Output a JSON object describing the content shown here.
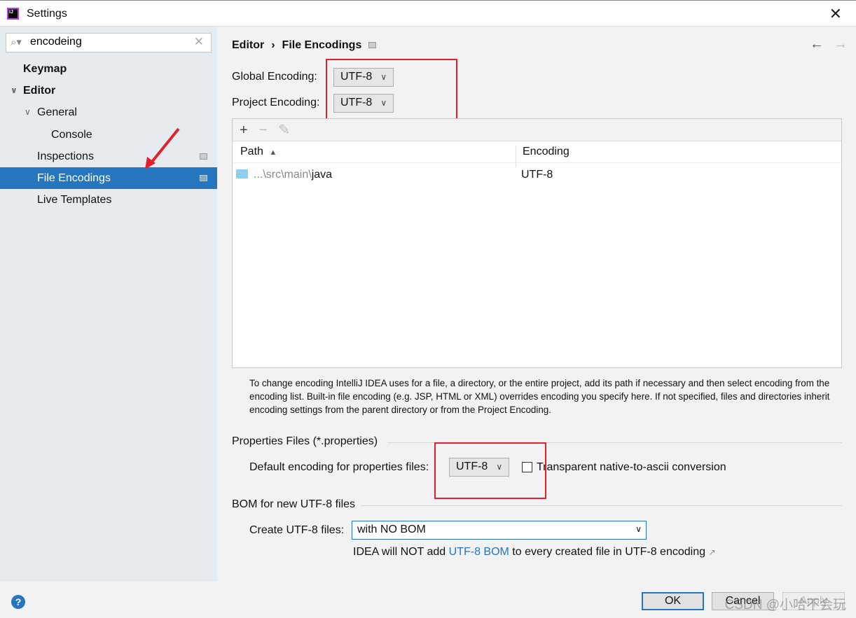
{
  "window": {
    "title": "Settings",
    "logo_text": "IJ",
    "close": "✕"
  },
  "sidebar": {
    "search_value": "encodeing",
    "items": [
      {
        "label": "Keymap"
      },
      {
        "label": "Editor"
      },
      {
        "label": "General"
      },
      {
        "label": "Console"
      },
      {
        "label": "Inspections"
      },
      {
        "label": "File Encodings"
      },
      {
        "label": "Live Templates"
      }
    ]
  },
  "main": {
    "breadcrumb": [
      "Editor",
      "›",
      "File Encodings"
    ],
    "nav_back": "←",
    "nav_forward": "→",
    "global_encoding": {
      "label": "Global Encoding:",
      "value": "UTF-8"
    },
    "project_encoding": {
      "label": "Project Encoding:",
      "value": "UTF-8"
    },
    "toolbar": {
      "add": "+",
      "remove": "−",
      "edit": "✎"
    },
    "table": {
      "columns": [
        "Path",
        "Encoding"
      ],
      "sort_indicator": "▲",
      "rows": [
        {
          "path_prefix": "...\\src\\main\\",
          "path_name": "java",
          "encoding": "UTF-8"
        }
      ]
    },
    "description": "To change encoding IntelliJ IDEA uses for a file, a directory, or the entire project, add its path if necessary and then select encoding from the encoding list. Built-in file encoding (e.g. JSP, HTML or XML) overrides encoding you specify here. If not specified, files and directories inherit encoding settings from the parent directory or from the Project Encoding.",
    "properties": {
      "section": "Properties Files (*.properties)",
      "label": "Default encoding for properties files:",
      "value": "UTF-8",
      "checkbox_label": "Transparent native-to-ascii conversion",
      "checked": false
    },
    "bom": {
      "section": "BOM for new UTF-8 files",
      "label": "Create UTF-8 files:",
      "value": "with NO BOM",
      "note_before": "IDEA will NOT add ",
      "note_link": "UTF-8 BOM",
      "note_after": " to every created file in UTF-8 encoding",
      "note_icon": "↗"
    }
  },
  "footer": {
    "help": "?",
    "ok": "OK",
    "cancel": "Cancel",
    "apply": "Apply",
    "watermark": "CSDN @小哈不会玩"
  },
  "colors": {
    "accent": "#2675bf",
    "highlight_box": "#e0212b",
    "annotation_arrow": "#e0212b"
  }
}
